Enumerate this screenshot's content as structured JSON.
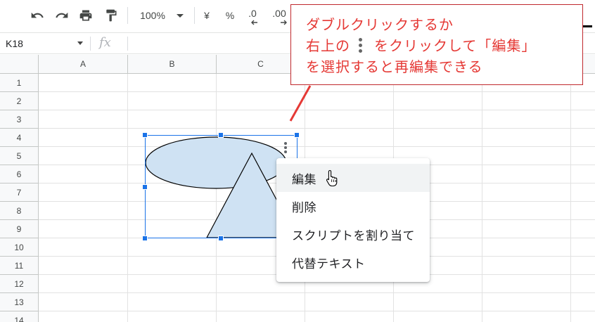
{
  "toolbar": {
    "undo_icon": "undo-icon",
    "redo_icon": "redo-icon",
    "print_icon": "print-icon",
    "paint_format_icon": "paint-format-icon",
    "zoom": "100%",
    "currency": "¥",
    "percent": "%",
    "decrease_decimal": ".0",
    "increase_decimal": ".00"
  },
  "formula_bar": {
    "name_box": "K18",
    "fx": "fx"
  },
  "sheet": {
    "columns": [
      "A",
      "B",
      "C"
    ],
    "rows": [
      "1",
      "2",
      "3",
      "4",
      "5",
      "6",
      "7",
      "8",
      "9",
      "10",
      "11",
      "12",
      "13",
      "14"
    ]
  },
  "drawing": {
    "fill": "#cfe2f3",
    "stroke": "#000000",
    "selection_color": "#1a73e8"
  },
  "context_menu": {
    "items": [
      {
        "label": "編集",
        "state": "hover"
      },
      {
        "label": "削除"
      },
      {
        "label": "スクリプトを割り当て"
      },
      {
        "label": "代替テキスト"
      }
    ]
  },
  "callout": {
    "line1": "ダブルクリックするか",
    "line2_before": "右上の",
    "line2_after": "をクリックして「編集」",
    "line3": "を選択すると再編集できる",
    "color": "#e53935",
    "border_color": "#c0282d"
  }
}
